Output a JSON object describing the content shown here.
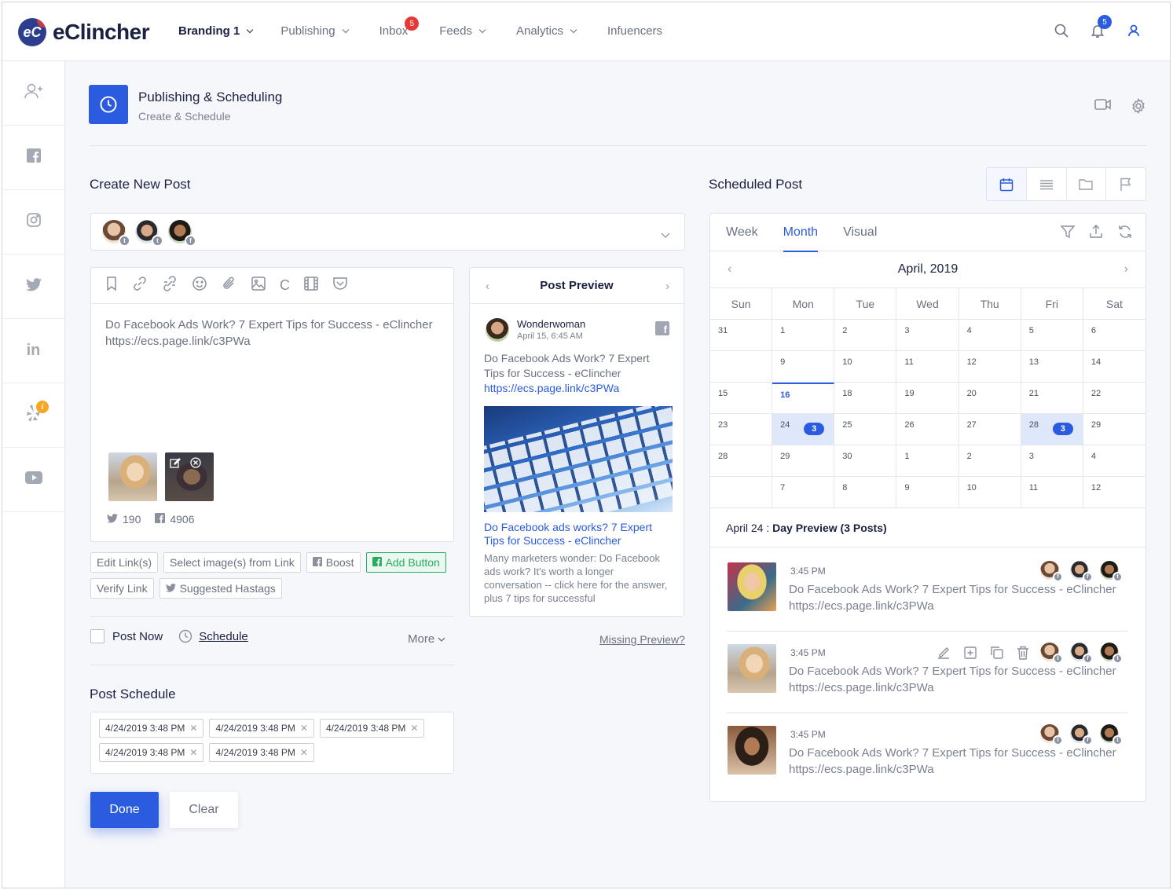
{
  "brand": {
    "logo_mark": "eC",
    "name": "eClincher"
  },
  "nav": {
    "workspace": "Branding 1",
    "items": [
      {
        "label": "Publishing",
        "dropdown": true
      },
      {
        "label": "Inbox",
        "badge": "5"
      },
      {
        "label": "Feeds",
        "dropdown": true
      },
      {
        "label": "Analytics",
        "dropdown": true
      },
      {
        "label": "Infuencers"
      }
    ],
    "notifications_badge": "5"
  },
  "sidebar": {
    "icons": [
      "add-user-icon",
      "facebook-icon",
      "instagram-icon",
      "twitter-icon",
      "linkedin-icon",
      "yelp-icon",
      "youtube-icon"
    ],
    "yelp_badge": "i"
  },
  "page": {
    "title": "Publishing & Scheduling",
    "subtitle": "Create & Schedule"
  },
  "create": {
    "title": "Create New Post",
    "editor_text_line1": "Do Facebook Ads Work? 7 Expert Tips for Success - eClincher",
    "editor_text_line2": "https://ecs.page.link/c3PWa",
    "twitter_count": "190",
    "facebook_count": "4906",
    "buttons_row1": [
      "Edit Link(s)",
      "Select image(s) from Link",
      "Boost",
      "Add Button"
    ],
    "buttons_row2": [
      "Verify Link",
      "Suggested Hastags"
    ],
    "post_now": "Post Now",
    "schedule": "Schedule",
    "more": "More",
    "missing_preview": "Missing Preview?",
    "post_schedule_title": "Post Schedule",
    "schedule_chips": [
      "4/24/2019  3:48 PM",
      "4/24/2019  3:48 PM",
      "4/24/2019  3:48 PM",
      "4/24/2019  3:48 PM",
      "4/24/2019  3:48 PM"
    ],
    "done": "Done",
    "clear": "Clear"
  },
  "preview": {
    "title": "Post Preview",
    "user": "Wonderwoman",
    "date": "April 15, 6:45 AM",
    "text": "Do Facebook Ads Work? 7 Expert Tips for Success - eClincher ",
    "link": "https://ecs.page.link/c3PWa",
    "link_title": "Do Facebook ads works? 7 Expert Tips for Success - eClincher",
    "description": "Many marketers wonder: Do Facebook ads work? It's worth a longer conversation -- click here for the answer, plus 7 tips for successful"
  },
  "scheduled": {
    "title": "Scheduled Post",
    "tabs": [
      "Week",
      "Month",
      "Visual"
    ],
    "active_tab": "Month",
    "month": "April, 2019",
    "days_of_week": [
      "Sun",
      "Mon",
      "Tue",
      "Wed",
      "Thu",
      "Fri",
      "Sat"
    ],
    "weeks": [
      [
        "31",
        "1",
        "2",
        "3",
        "4",
        "5",
        "6"
      ],
      [
        "",
        "9",
        "10",
        "11",
        "12",
        "13",
        "14"
      ],
      [
        "15",
        "16",
        "18",
        "19",
        "20",
        "21",
        "22"
      ],
      [
        "23",
        "24",
        "25",
        "26",
        "27",
        "28",
        "29"
      ],
      [
        "28",
        "29",
        "30",
        "1",
        "2",
        "3",
        "4"
      ],
      [
        "",
        "7",
        "8",
        "9",
        "10",
        "11",
        "12"
      ]
    ],
    "today": "16",
    "counts": {
      "24": "3",
      "28": "3"
    },
    "day_preview_date": "April 24 :",
    "day_preview_label": " Day Preview (3 Posts)",
    "posts": [
      {
        "time": "3:45 PM",
        "line1": "Do Facebook Ads Work? 7 Expert Tips for Success - eClincher",
        "line2": "https://ecs.page.link/c3PWa"
      },
      {
        "time": "3:45 PM",
        "line1": "Do Facebook Ads Work? 7 Expert Tips for Success - eClincher",
        "line2": "https://ecs.page.link/c3PWa"
      },
      {
        "time": "3:45 PM",
        "line1": "Do Facebook Ads Work? 7 Expert Tips for Success - eClincher",
        "line2": "https://ecs.page.link/c3PWa"
      }
    ]
  },
  "colors": {
    "accent": "#2b5bde",
    "badge_red": "#e53935",
    "green": "#27ae60",
    "yelp_badge": "#f5a623"
  }
}
